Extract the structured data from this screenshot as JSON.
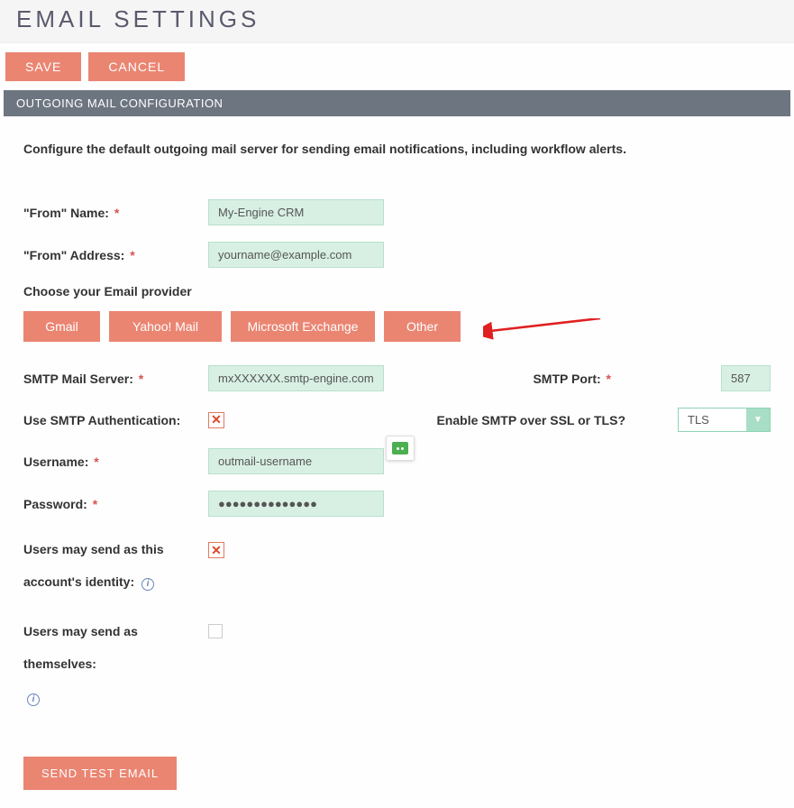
{
  "page_title": "EMAIL SETTINGS",
  "buttons": {
    "save": "SAVE",
    "cancel": "CANCEL",
    "send_test": "SEND TEST EMAIL"
  },
  "section_header": "OUTGOING MAIL CONFIGURATION",
  "description": "Configure the default outgoing mail server for sending email notifications, including workflow alerts.",
  "labels": {
    "from_name": "\"From\" Name:",
    "from_address": "\"From\" Address:",
    "provider": "Choose your Email provider",
    "smtp_server": "SMTP Mail Server:",
    "smtp_port": "SMTP Port:",
    "use_auth": "Use SMTP Authentication:",
    "enable_ssl": "Enable SMTP over SSL or TLS?",
    "username": "Username:",
    "password": "Password:",
    "send_as_identity": "Users may send as this account's identity:",
    "send_as_self": "Users may send as themselves:"
  },
  "providers": {
    "gmail": "Gmail",
    "yahoo": "Yahoo! Mail",
    "exchange": "Microsoft Exchange",
    "other": "Other"
  },
  "values": {
    "from_name": "My-Engine CRM",
    "from_address": "yourname@example.com",
    "smtp_server": "mxXXXXXX.smtp-engine.com",
    "smtp_port": "587",
    "tls_select": "TLS",
    "username": "outmail-username",
    "password": "●●●●●●●●●●●●●●",
    "use_auth_checked": "✕",
    "send_as_identity_checked": "✕"
  },
  "asterisk": "*"
}
